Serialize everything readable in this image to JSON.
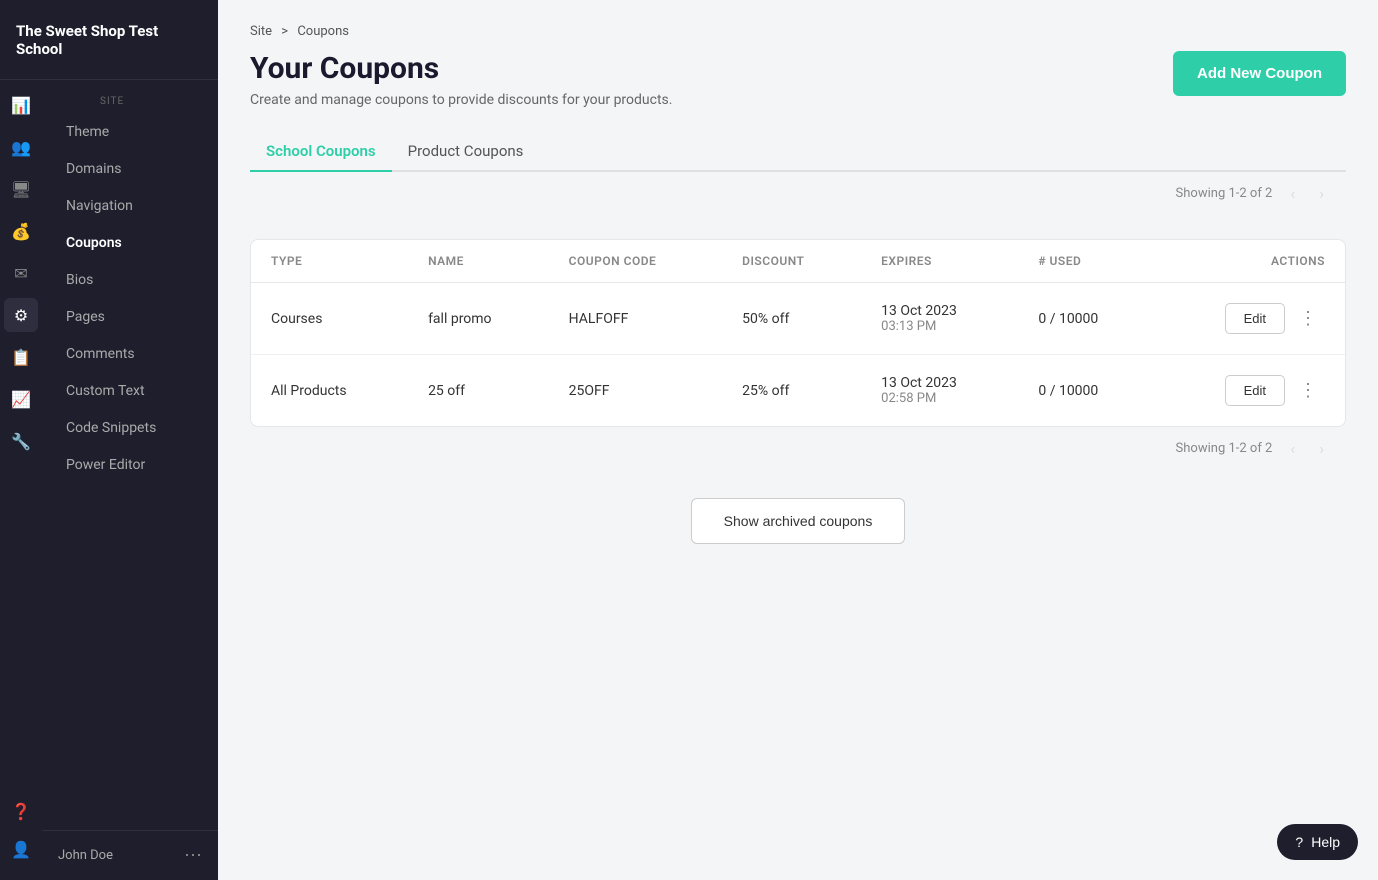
{
  "app": {
    "school_name": "The Sweet Shop Test School"
  },
  "sidebar": {
    "section_label": "SITE",
    "menu_items": [
      {
        "id": "theme",
        "label": "Theme",
        "icon": "🎨"
      },
      {
        "id": "domains",
        "label": "Domains",
        "icon": "🌐"
      },
      {
        "id": "navigation",
        "label": "Navigation",
        "icon": "☰"
      },
      {
        "id": "coupons",
        "label": "Coupons",
        "icon": "🏷"
      },
      {
        "id": "bios",
        "label": "Bios",
        "icon": "👤"
      },
      {
        "id": "pages",
        "label": "Pages",
        "icon": "📄"
      },
      {
        "id": "comments",
        "label": "Comments",
        "icon": "💬"
      },
      {
        "id": "custom_text",
        "label": "Custom Text",
        "icon": "✏"
      },
      {
        "id": "code_snippets",
        "label": "Code Snippets",
        "icon": "⌨"
      },
      {
        "id": "power_editor",
        "label": "Power Editor",
        "icon": "⚡"
      }
    ],
    "footer": {
      "user_name": "John Doe",
      "more_icon": "⋯"
    }
  },
  "breadcrumb": {
    "site_label": "Site",
    "separator": ">",
    "current": "Coupons"
  },
  "page": {
    "title": "Your Coupons",
    "subtitle": "Create and manage coupons to provide discounts for your products.",
    "add_button_label": "Add New Coupon"
  },
  "tabs": [
    {
      "id": "school_coupons",
      "label": "School Coupons",
      "active": true
    },
    {
      "id": "product_coupons",
      "label": "Product Coupons",
      "active": false
    }
  ],
  "table": {
    "pagination_label": "Showing 1-2 of 2",
    "columns": [
      {
        "id": "type",
        "label": "TYPE"
      },
      {
        "id": "name",
        "label": "NAME"
      },
      {
        "id": "coupon_code",
        "label": "COUPON CODE"
      },
      {
        "id": "discount",
        "label": "DISCOUNT"
      },
      {
        "id": "expires",
        "label": "EXPIRES"
      },
      {
        "id": "used",
        "label": "# USED"
      },
      {
        "id": "actions",
        "label": "ACTIONS"
      }
    ],
    "rows": [
      {
        "type": "Courses",
        "name": "fall promo",
        "coupon_code": "HALFOFF",
        "discount": "50% off",
        "expires": "13 Oct 2023\n03:13 PM",
        "expires_line1": "13 Oct 2023",
        "expires_line2": "03:13 PM",
        "used": "0 / 10000",
        "edit_label": "Edit"
      },
      {
        "type": "All Products",
        "name": "25 off",
        "coupon_code": "25OFF",
        "discount": "25% off",
        "expires": "13 Oct 2023\n02:58 PM",
        "expires_line1": "13 Oct 2023",
        "expires_line2": "02:58 PM",
        "used": "0 / 10000",
        "edit_label": "Edit"
      }
    ]
  },
  "show_archived_label": "Show archived coupons",
  "help_button_label": "Help"
}
